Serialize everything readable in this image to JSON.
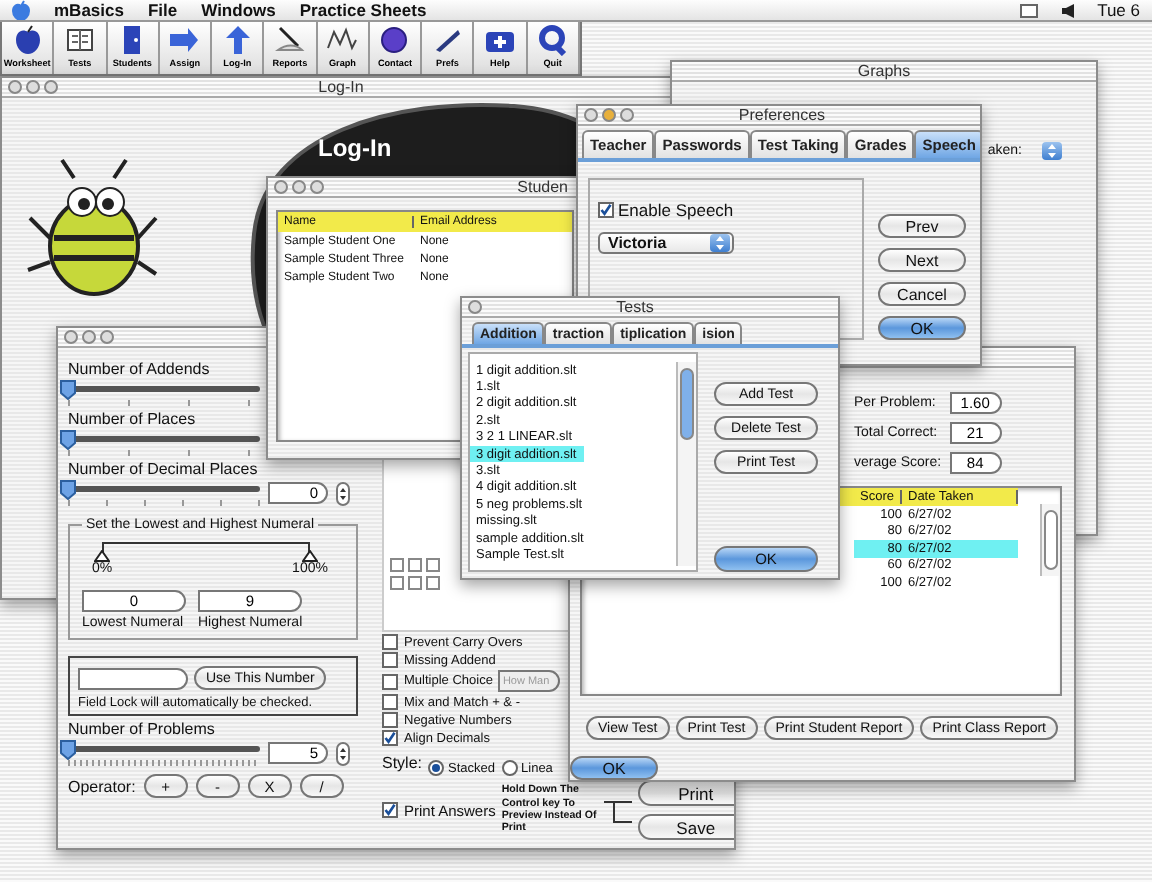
{
  "menu_bar": {
    "menus": [
      "mBasics",
      "File",
      "Windows",
      "Practice Sheets"
    ],
    "clock": "Tue 6"
  },
  "toolbar": [
    {
      "label": "Worksheet"
    },
    {
      "label": "Tests"
    },
    {
      "label": "Students"
    },
    {
      "label": "Assign"
    },
    {
      "label": "Log-In"
    },
    {
      "label": "Reports"
    },
    {
      "label": "Graph"
    },
    {
      "label": "Contact"
    },
    {
      "label": "Prefs"
    },
    {
      "label": "Help"
    },
    {
      "label": "Quit"
    }
  ],
  "login_window": {
    "title": "Log-In",
    "heading": "Log-In"
  },
  "graphs_window": {
    "title": "Graphs",
    "filter_label": "aken:"
  },
  "settings_window": {
    "sliders": [
      {
        "label": "Number of Addends",
        "level": 0
      },
      {
        "label": "Number of Places",
        "level": 0
      },
      {
        "label": "Number of Decimal Places",
        "level": 0,
        "value": "0"
      }
    ],
    "range": {
      "title": "Set the Lowest and Highest Numeral",
      "thumbs": [
        {
          "label": "0%",
          "level": 0
        },
        {
          "label": "100%",
          "level": 1
        }
      ],
      "fields": [
        {
          "value": "0",
          "label": "Lowest Numeral"
        },
        {
          "value": "9",
          "label": "Highest Numeral"
        }
      ]
    },
    "lock": {
      "button": "Use This Number",
      "note": "Field Lock will automatically be checked."
    },
    "problems": {
      "label": "Number of Problems",
      "level": 0,
      "value": "5"
    },
    "operator": {
      "label": "Operator:",
      "buttons": [
        "+",
        "-",
        "X",
        "/"
      ]
    },
    "options": [
      {
        "label": "Prevent Carry Overs",
        "checked": false
      },
      {
        "label": "Missing Addend",
        "checked": false
      },
      {
        "label": "Multiple Choice",
        "checked": false,
        "placeholder": "How Man"
      },
      {
        "label": "Mix and Match + & -",
        "checked": false
      },
      {
        "label": "Negative Numbers",
        "checked": false
      },
      {
        "label": "Align Decimals",
        "checked": true
      }
    ],
    "style": {
      "label": "Style:",
      "choices": [
        {
          "label": "Stacked",
          "selected": true
        },
        {
          "label": "Linea",
          "selected": false
        }
      ]
    },
    "hint": "Hold Down The Control key To Preview Instead Of Print",
    "buttons": [
      "Print",
      "Save"
    ],
    "print_answers": {
      "label": "Print Answers",
      "checked": true
    }
  },
  "students_window": {
    "title": "Studen",
    "columns": [
      "Name",
      "Email Address"
    ],
    "rows": [
      [
        "Sample Student One",
        "None"
      ],
      [
        "Sample Student Three",
        "None"
      ],
      [
        "Sample Student Two",
        "None"
      ]
    ]
  },
  "report_window": {
    "fields": [
      {
        "label": "Per Problem:",
        "value": "1.60"
      },
      {
        "label": "Total Correct:",
        "value": "21"
      },
      {
        "label": "verage Score:",
        "value": "84"
      }
    ],
    "columns": [
      "Score",
      "Date Taken"
    ],
    "rows": [
      {
        "score": "100",
        "date": "6/27/02",
        "selected": false
      },
      {
        "score": "80",
        "date": "6/27/02",
        "selected": false
      },
      {
        "score": "80",
        "date": "6/27/02",
        "selected": true
      },
      {
        "score": "60",
        "date": "6/27/02",
        "selected": false
      },
      {
        "score": "100",
        "date": "6/27/02",
        "selected": false
      }
    ],
    "buttons": [
      "View Test",
      "Print Test",
      "Print Student Report",
      "Print Class Report"
    ],
    "confirm": "OK"
  },
  "preferences_window": {
    "title": "Preferences",
    "tabs": [
      {
        "label": "Teacher",
        "selected": false
      },
      {
        "label": "Passwords",
        "selected": false
      },
      {
        "label": "Test Taking",
        "selected": false
      },
      {
        "label": "Grades",
        "selected": false
      },
      {
        "label": "Speech",
        "selected": true
      }
    ],
    "enable_speech": {
      "label": "Enable Speech",
      "checked": true
    },
    "voice": "Victoria",
    "buttons": [
      {
        "label": "Prev",
        "default": false
      },
      {
        "label": "Next",
        "default": false
      },
      {
        "label": "Cancel",
        "default": false
      },
      {
        "label": "OK",
        "default": true
      }
    ]
  },
  "tests_window": {
    "title": "Tests",
    "tabs": [
      {
        "label": "Addition",
        "selected": true
      },
      {
        "label": "traction",
        "selected": false
      },
      {
        "label": "tiplication",
        "selected": false
      },
      {
        "label": "ision",
        "selected": false
      }
    ],
    "items": [
      {
        "label": "1 digit addition.slt",
        "selected": false
      },
      {
        "label": "1.slt",
        "selected": false
      },
      {
        "label": "2 digit addition.slt",
        "selected": false
      },
      {
        "label": "2.slt",
        "selected": false
      },
      {
        "label": "3 2 1 LINEAR.slt",
        "selected": false
      },
      {
        "label": "3 digit addition.slt",
        "selected": true
      },
      {
        "label": "3.slt",
        "selected": false
      },
      {
        "label": "4 digit addition.slt",
        "selected": false
      },
      {
        "label": "5 neg problems.slt",
        "selected": false
      },
      {
        "label": "missing.slt",
        "selected": false
      },
      {
        "label": "sample addition.slt",
        "selected": false
      },
      {
        "label": "Sample Test.slt",
        "selected": false
      }
    ],
    "buttons": [
      "Add Test",
      "Delete Test",
      "Print Test"
    ],
    "confirm": "OK"
  }
}
